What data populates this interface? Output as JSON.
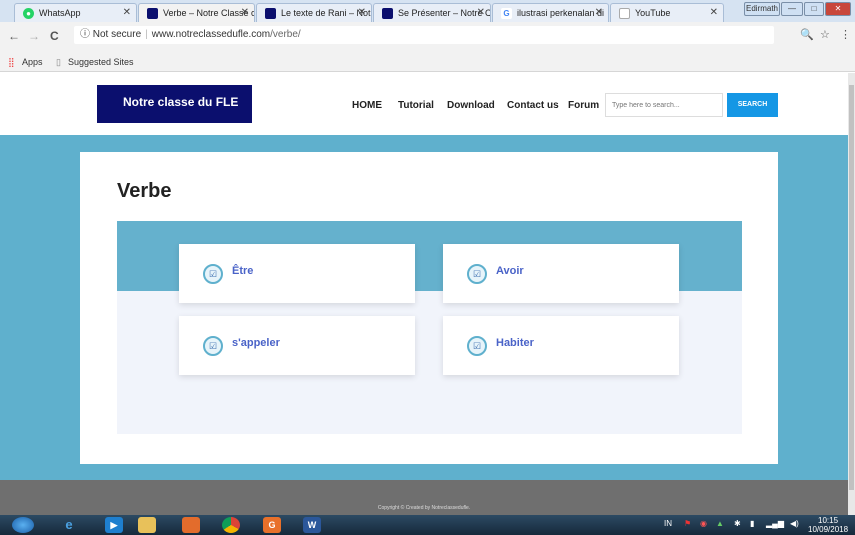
{
  "tabs": [
    {
      "title": "WhatsApp",
      "icon": "whatsapp-icon",
      "color": "#25d366"
    },
    {
      "title": "Verbe – Notre Classe c",
      "icon": "site-icon",
      "color": "#0b0f6e"
    },
    {
      "title": "Le texte de Rani – Not",
      "icon": "site-icon",
      "color": "#0b0f6e"
    },
    {
      "title": "Se Présenter – Notre C",
      "icon": "site-icon",
      "color": "#0b0f6e"
    },
    {
      "title": "ilustrasi perkenalan di",
      "icon": "google-icon",
      "color": "#4285f4"
    },
    {
      "title": "YouTube",
      "icon": "page-icon",
      "color": "#888888"
    }
  ],
  "window_buttons": [
    "Edirmath",
    "—",
    "□",
    "✕"
  ],
  "toolbar": {
    "back": "←",
    "forward": "→",
    "reload": "C",
    "security": "ⓘ Not secure",
    "domain": "www.notreclassedufle.com",
    "path": "/verbe/",
    "zoom": "🔍",
    "star": "☆",
    "menu": "⋮"
  },
  "bookmarks": {
    "apps": "Apps",
    "suggested": "Suggested Sites"
  },
  "header": {
    "logo": "Notre classe du FLE",
    "nav": [
      "HOME",
      "Tutorial",
      "Download",
      "Contact us",
      "Forum"
    ],
    "search_placeholder": "Type here to search...",
    "search_button": "SEARCH"
  },
  "page": {
    "title": "Verbe",
    "verbs": [
      "Être",
      "Avoir",
      "s'appeler",
      "Habiter"
    ]
  },
  "footer": {
    "copyright": "Copyright © Created by Notreclassedufle."
  },
  "taskbar": {
    "lang": "IN",
    "time": "10:15",
    "date": "10/09/2018"
  },
  "colors": {
    "brand": "#0b0f6e",
    "accent": "#5fb0cd",
    "search": "#1597e5",
    "link": "#4a63c8"
  }
}
